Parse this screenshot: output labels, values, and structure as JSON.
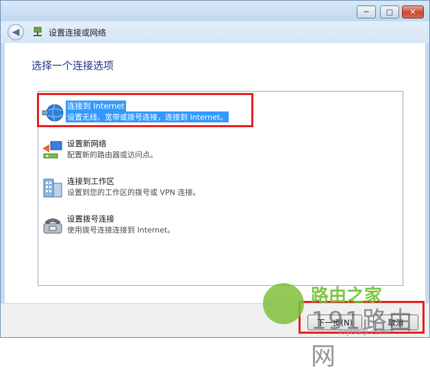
{
  "window": {
    "minimize_label": "─",
    "maximize_label": "□",
    "close_label": "✕",
    "accent_color": "#c7dbf0"
  },
  "nav": {
    "back_label": "◀",
    "title": "设置连接或网络"
  },
  "page": {
    "heading": "选择一个连接选项"
  },
  "options": [
    {
      "title": "连接到 Internet",
      "description": "设置无线、宽带或拨号连接，连接到 Internet。",
      "icon": "globe-network-icon",
      "selected": true
    },
    {
      "title": "设置新网络",
      "description": "配置新的路由器或访问点。",
      "icon": "new-network-icon",
      "selected": false
    },
    {
      "title": "连接到工作区",
      "description": "设置到您的工作区的拨号或 VPN 连接。",
      "icon": "workplace-icon",
      "selected": false
    },
    {
      "title": "设置拨号连接",
      "description": "使用拨号连接连接到 Internet。",
      "icon": "dialup-phone-icon",
      "selected": false
    }
  ],
  "footer": {
    "next_label": "下一步(N)",
    "cancel_label": "取消"
  },
  "watermark": {
    "line1": "路由之家",
    "line2": "191路由网",
    "line3": "luyouqi.com"
  },
  "colors": {
    "highlight_red": "#e51e1e",
    "selection_blue": "#3399ff",
    "heading_blue": "#1e3287"
  }
}
